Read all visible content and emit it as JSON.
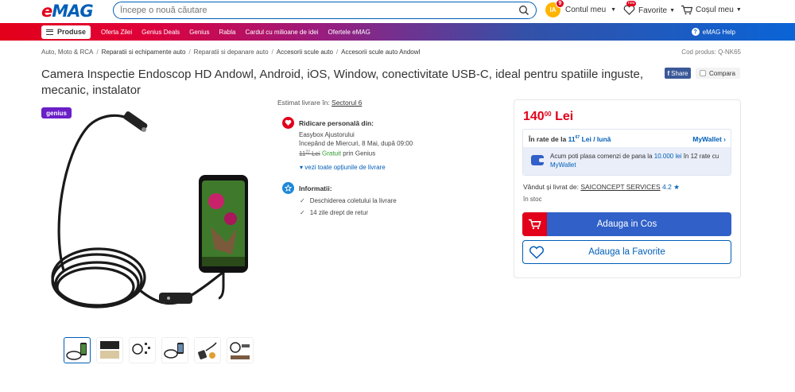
{
  "header": {
    "logo_e": "e",
    "logo_mag": "MAG",
    "search_placeholder": "Începe o nouă căutare",
    "avatar_initials": "IA",
    "avatar_badge": "9",
    "account_label": "Contul meu",
    "favorites_label": "Favorite",
    "favorites_new": "nou",
    "cart_label": "Coșul meu"
  },
  "nav": {
    "produse": "Produse",
    "links": [
      "Oferta Zilei",
      "Genius Deals",
      "Genius",
      "Rabla",
      "Cardul cu milioane de idei",
      "Ofertele eMAG"
    ],
    "help": "eMAG Help"
  },
  "breadcrumb": {
    "items": [
      "Auto, Moto & RCA",
      "Reparatii si echipamente auto",
      "Reparatii si depanare auto",
      "Accesorii scule auto",
      "Accesorii scule auto Andowl"
    ],
    "product_code": "Cod produs: Q-NK65"
  },
  "product": {
    "title": "Camera Inspectie Endoscop HD Andowl, Android, iOS, Window, conectivitate USB-C, ideal pentru spatiile inguste, mecanic, instalator",
    "share": "Share",
    "compare": "Compara",
    "genius_badge": "genius"
  },
  "delivery": {
    "estimate_label": "Estimat livrare în:",
    "estimate_location": "Sectorul 6",
    "pickup_title": "Ridicare personală din:",
    "pickup_place": "Easybox Ajustorului",
    "pickup_date": "începând de Miercuri, 8 Mai, după 09:00",
    "pickup_old_price": "11",
    "pickup_old_price_dec": "22",
    "pickup_old_currency": "Lei",
    "pickup_free": "Gratuit",
    "pickup_genius": "prin Genius",
    "see_all": "vezi toate opțiunile de livrare",
    "info_title": "Informatii:",
    "info_items": [
      "Deschiderea coletului la livrare",
      "14 zile drept de retur"
    ]
  },
  "pricing": {
    "price_int": "140",
    "price_dec": "00",
    "currency": "Lei",
    "rate_prefix": "În rate de la",
    "rate_int": "11",
    "rate_dec": "67",
    "rate_suffix": "Lei / lună",
    "mywallet_label": "MyWallet",
    "rate_info_1": "Acum poti plasa comenzi de pana la",
    "rate_info_amount": "10.000 lei",
    "rate_info_2": "în 12 rate cu",
    "rate_info_link": "MyWallet",
    "sold_by_label": "Vândut și livrat de:",
    "seller": "SAICONCEPT SERVICES",
    "seller_rating": "4.2",
    "stock": "în stoc",
    "add_to_cart": "Adauga in Cos",
    "add_to_fav": "Adauga la Favorite"
  },
  "colors": {
    "brand_red": "#e2001a",
    "brand_blue": "#005eb8",
    "button_blue": "#3060c8",
    "genius_purple": "#6a1fc7"
  }
}
